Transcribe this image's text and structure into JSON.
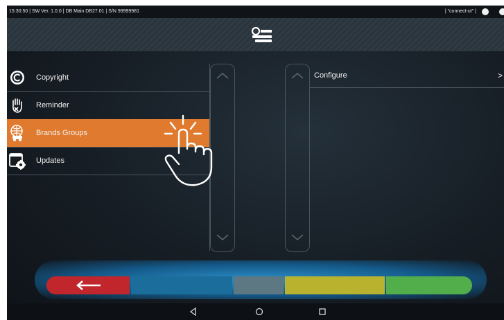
{
  "status_bar": {
    "left_text": "15:30:50  |  SW Ver. 1.0.0  |  DB Main DB27.01  |  S/N 99999981",
    "right_text": "|  \"connect-ut\"  |"
  },
  "header": {
    "icon": "settings-list-icon"
  },
  "menu": {
    "items": [
      {
        "label": "Copyright",
        "icon": "copyright-icon"
      },
      {
        "label": "Reminder",
        "icon": "reminder-hand-icon"
      },
      {
        "label": "Brands Groups",
        "icon": "brands-groups-icon",
        "active": true
      },
      {
        "label": "Updates",
        "icon": "updates-icon"
      }
    ]
  },
  "right_panel": {
    "item_label": "Configure",
    "arrow": ">"
  },
  "action_bar": {
    "back_symbol": "⟵",
    "colors": {
      "red": "#c0262b",
      "blue": "#1b6e9c",
      "grey": "#5d7882",
      "yellow": "#b9b22f",
      "green": "#52ae4a"
    }
  },
  "nav": {
    "back": "◁",
    "home": "○",
    "recents": "□"
  },
  "colors": {
    "accent": "#e07a2e",
    "background": "#161d24"
  }
}
